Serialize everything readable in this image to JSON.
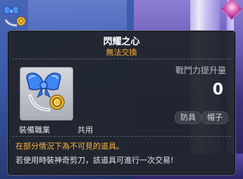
{
  "item": {
    "name": "閃耀之心",
    "trade_status": "無法交換",
    "icon": "heart-bow-headband-icon",
    "job_label": "裝備職業",
    "job_value": "共用",
    "power_label": "戰鬥力提升量",
    "power_value": "0",
    "tags": [
      "防具",
      "帽子"
    ],
    "notice_warning": "在部分情況下為不可見的道具。",
    "notice_info": "若使用時裝神奇剪刀，該道具可進行一次交易!"
  },
  "colors": {
    "tooltip_bg": "#21252c",
    "name_text": "#ffffff",
    "warning_text": "#ffb23c",
    "tag_bg": "#3a3f48"
  }
}
